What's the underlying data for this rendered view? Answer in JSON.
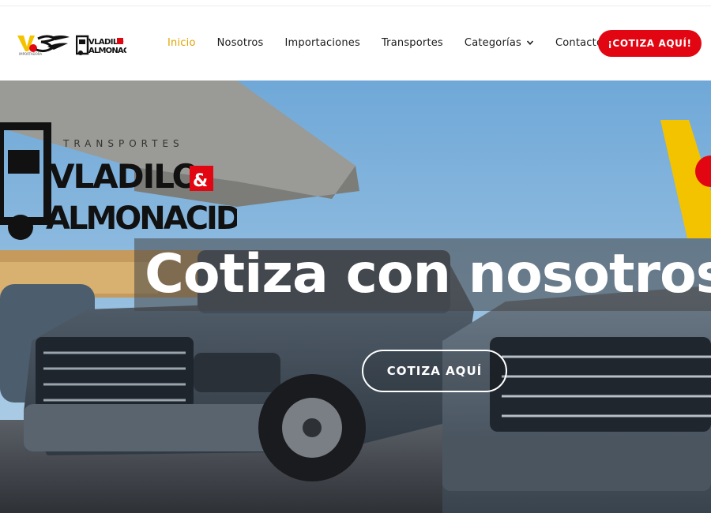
{
  "header": {
    "logo_primary_text": "VS",
    "logo_primary_sub": "IMPORTADORA",
    "logo_secondary_text": "VLADILO & ALMONACID",
    "nav": [
      {
        "label": "Inicio",
        "active": true
      },
      {
        "label": "Nosotros",
        "active": false
      },
      {
        "label": "Importaciones",
        "active": false
      },
      {
        "label": "Transportes",
        "active": false
      },
      {
        "label": "Categorías",
        "active": false,
        "has_dropdown": true
      },
      {
        "label": "Contacto",
        "active": false
      }
    ],
    "cta_label": "¡COTIZA AQUÍ!"
  },
  "hero": {
    "title": "Cotiza con nosotros",
    "button_label": "COTIZA AQUÍ",
    "banner_transportes": "TRANSPORTES",
    "banner_line1": "VLADILO",
    "banner_amp": "&",
    "banner_line2": "ALMONACID"
  },
  "colors": {
    "accent_active": "#e2a400",
    "cta_red": "#e20613",
    "brand_yellow": "#f3c300"
  }
}
